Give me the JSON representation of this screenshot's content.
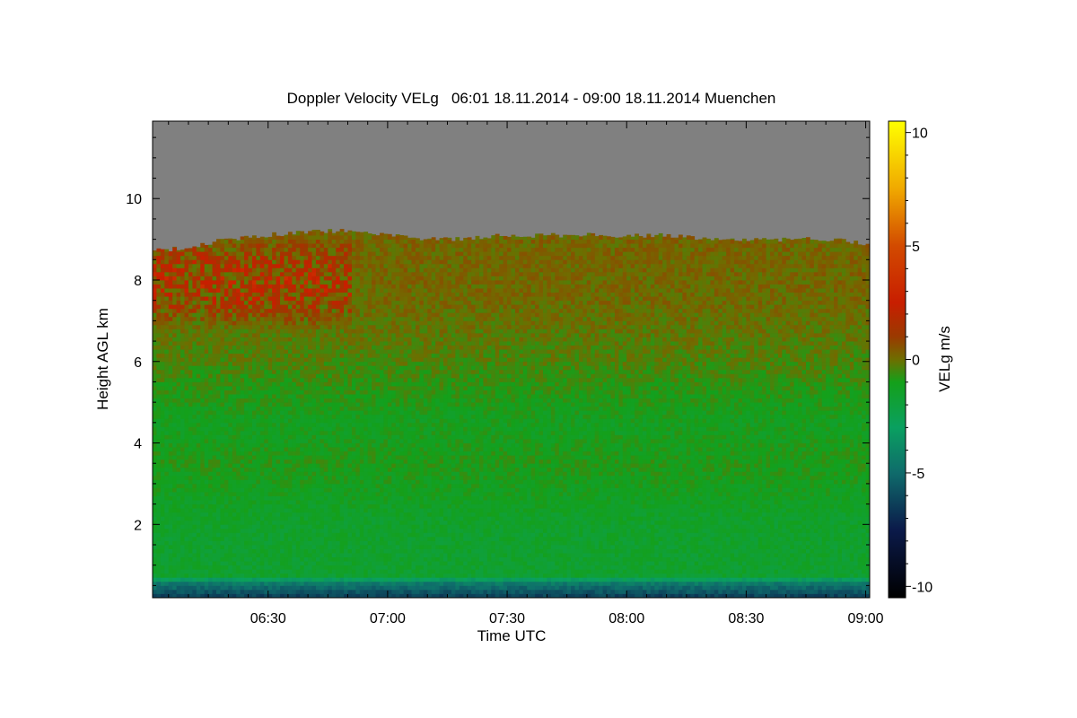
{
  "chart_data": {
    "type": "heatmap",
    "title": "Doppler Velocity VELg   06:01 18.11.2014 - 09:00 18.11.2014 Muenchen",
    "xlabel": "Time UTC",
    "ylabel": "Height AGL km",
    "x_ticks": [
      "06:30",
      "07:00",
      "07:30",
      "08:00",
      "08:30",
      "09:00"
    ],
    "x_tick_minutes": [
      390,
      420,
      450,
      480,
      510,
      540
    ],
    "xlim_minutes": [
      361,
      541
    ],
    "y_ticks": [
      2,
      4,
      6,
      8,
      10
    ],
    "ylim": [
      0.2,
      11.9
    ],
    "colorbar": {
      "label": "VELg m/s",
      "ticks": [
        10,
        5,
        0,
        -5,
        -10
      ],
      "range": [
        -10.5,
        10.5
      ],
      "stops": [
        {
          "value": -10.5,
          "color": "#000000"
        },
        {
          "value": -7.5,
          "color": "#0b1a4a"
        },
        {
          "value": -5,
          "color": "#0f6b6b"
        },
        {
          "value": -3,
          "color": "#0aa060"
        },
        {
          "value": -1,
          "color": "#14a01a"
        },
        {
          "value": 0,
          "color": "#6e6e00"
        },
        {
          "value": 1,
          "color": "#9a3a00"
        },
        {
          "value": 2.5,
          "color": "#c81e00"
        },
        {
          "value": 5,
          "color": "#d24a00"
        },
        {
          "value": 7.5,
          "color": "#f0a800"
        },
        {
          "value": 10.5,
          "color": "#ffff00"
        }
      ]
    },
    "no_signal_color": "#808080",
    "cloud_top_km": [
      {
        "t": 361,
        "h": 8.7
      },
      {
        "t": 370,
        "h": 8.8
      },
      {
        "t": 380,
        "h": 9.0
      },
      {
        "t": 390,
        "h": 9.1
      },
      {
        "t": 400,
        "h": 9.2
      },
      {
        "t": 410,
        "h": 9.2
      },
      {
        "t": 420,
        "h": 9.1
      },
      {
        "t": 430,
        "h": 9.0
      },
      {
        "t": 440,
        "h": 9.0
      },
      {
        "t": 450,
        "h": 9.1
      },
      {
        "t": 460,
        "h": 9.1
      },
      {
        "t": 470,
        "h": 9.1
      },
      {
        "t": 480,
        "h": 9.1
      },
      {
        "t": 490,
        "h": 9.1
      },
      {
        "t": 500,
        "h": 9.0
      },
      {
        "t": 510,
        "h": 9.0
      },
      {
        "t": 520,
        "h": 9.0
      },
      {
        "t": 530,
        "h": 9.0
      },
      {
        "t": 541,
        "h": 8.9
      }
    ],
    "velocity_profile": [
      {
        "h": 0.2,
        "v": -6.5
      },
      {
        "h": 0.55,
        "v": -4.5
      },
      {
        "h": 0.75,
        "v": -1.6
      },
      {
        "h": 2.0,
        "v": -1.5
      },
      {
        "h": 3.5,
        "v": -0.9
      },
      {
        "h": 4.5,
        "v": -1.2
      },
      {
        "h": 6.0,
        "v": -0.4
      },
      {
        "h": 7.5,
        "v": 0.1
      },
      {
        "h": 9.2,
        "v": 0.2
      }
    ],
    "updraft_region": {
      "t_start": 361,
      "t_end": 410,
      "h_min": 6.8,
      "h_max": 9.1,
      "v_max": 2.5
    }
  }
}
